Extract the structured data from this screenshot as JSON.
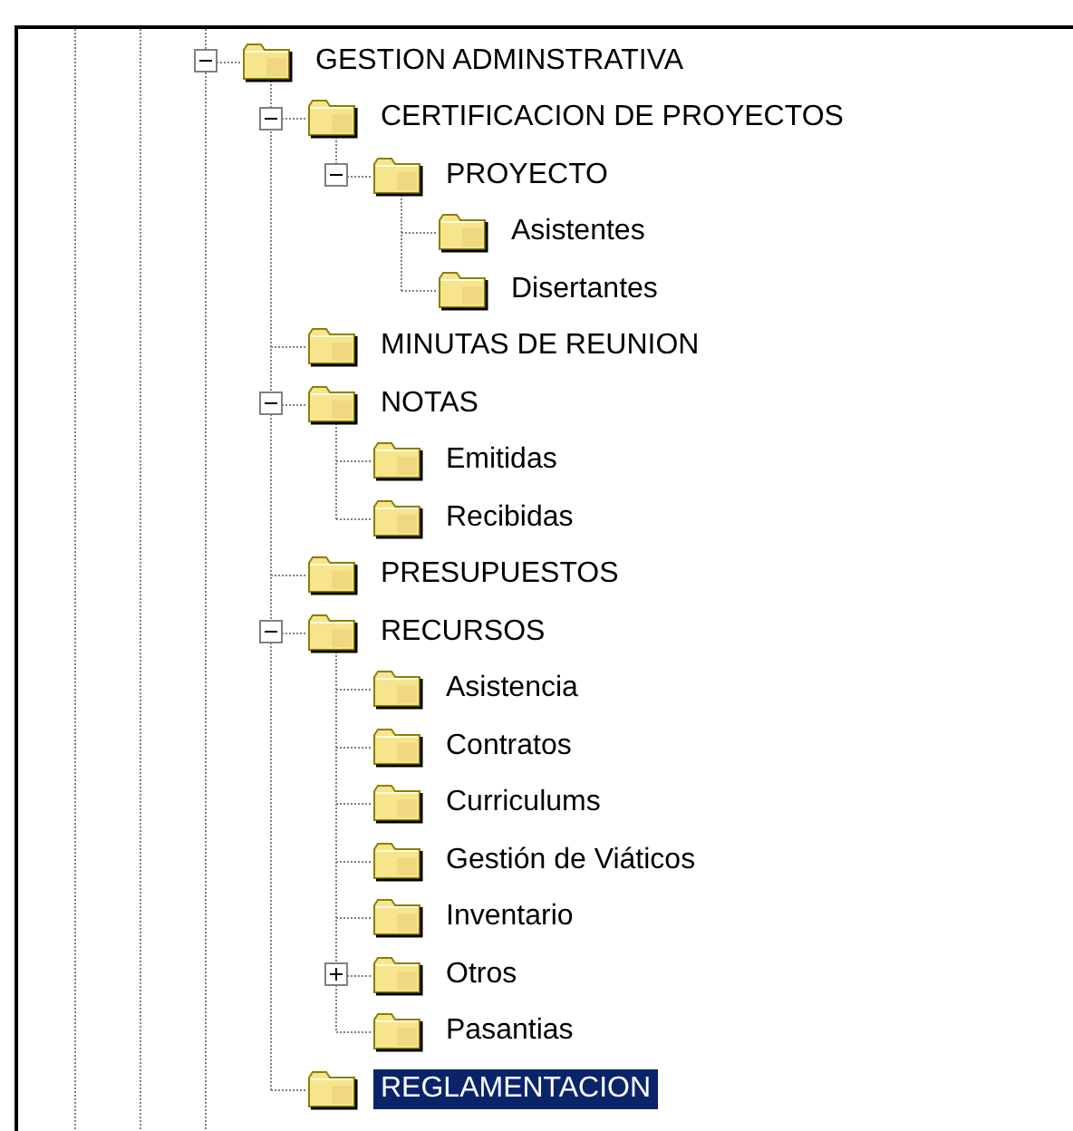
{
  "tree": [
    {
      "label": "GESTION ADMINSTRATIVA",
      "selected": false,
      "expanded": true,
      "children": [
        {
          "label": "CERTIFICACION DE PROYECTOS",
          "selected": false,
          "expanded": true,
          "children": [
            {
              "label": "PROYECTO",
              "selected": false,
              "expanded": true,
              "children": [
                {
                  "label": "Asistentes",
                  "selected": false
                },
                {
                  "label": "Disertantes",
                  "selected": false
                }
              ]
            }
          ]
        },
        {
          "label": "MINUTAS DE REUNION",
          "selected": false
        },
        {
          "label": "NOTAS",
          "selected": false,
          "expanded": true,
          "children": [
            {
              "label": "Emitidas",
              "selected": false
            },
            {
              "label": "Recibidas",
              "selected": false
            }
          ]
        },
        {
          "label": "PRESUPUESTOS",
          "selected": false
        },
        {
          "label": "RECURSOS",
          "selected": false,
          "expanded": true,
          "children": [
            {
              "label": "Asistencia",
              "selected": false
            },
            {
              "label": "Contratos",
              "selected": false
            },
            {
              "label": "Curriculums",
              "selected": false
            },
            {
              "label": "Gestión de Viáticos",
              "selected": false
            },
            {
              "label": "Inventario",
              "selected": false
            },
            {
              "label": "Otros",
              "selected": false,
              "expanded": false
            },
            {
              "label": "Pasantias",
              "selected": false
            }
          ]
        },
        {
          "label": "REGLAMENTACION",
          "selected": true
        }
      ]
    }
  ]
}
